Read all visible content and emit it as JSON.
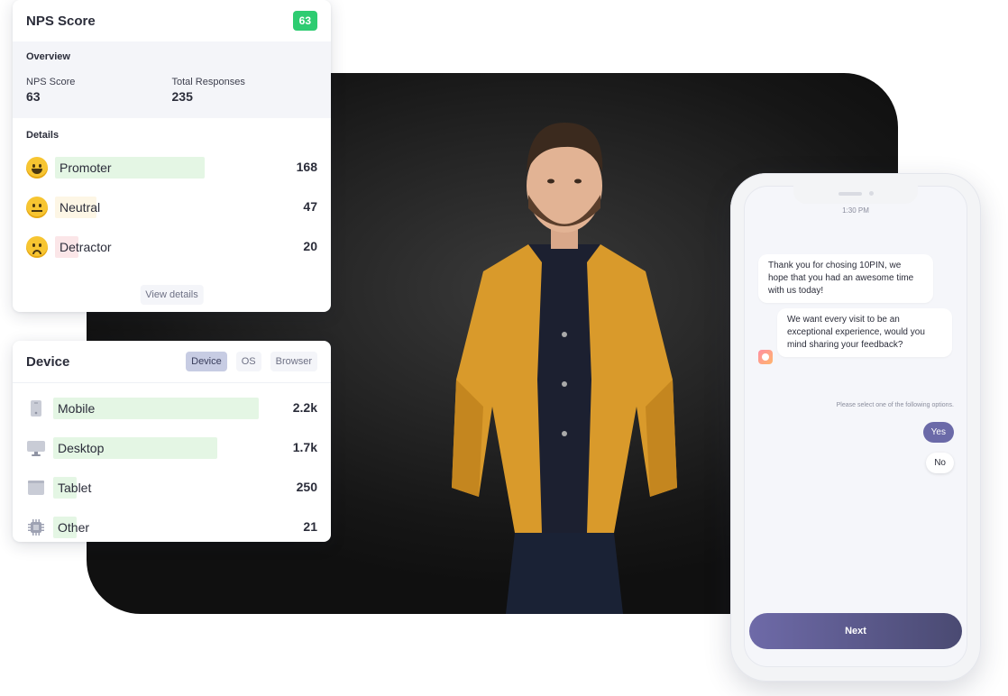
{
  "nps_card": {
    "title": "NPS Score",
    "badge": "63",
    "overview_label": "Overview",
    "stats": [
      {
        "label": "NPS Score",
        "value": "63"
      },
      {
        "label": "Total Responses",
        "value": "235"
      }
    ],
    "details_label": "Details",
    "rows": [
      {
        "label": "Promoter",
        "count": "168",
        "fraction": 0.72,
        "color": "#e4f6e4",
        "icon": "happy-face-icon"
      },
      {
        "label": "Neutral",
        "count": "47",
        "fraction": 0.2,
        "color": "#fdf6e5",
        "icon": "neutral-face-icon"
      },
      {
        "label": "Detractor",
        "count": "20",
        "fraction": 0.09,
        "color": "#fbe6e8",
        "icon": "sad-face-icon"
      }
    ],
    "view_details": "View details"
  },
  "device_card": {
    "title": "Device",
    "tabs": [
      "Device",
      "OS",
      "Browser"
    ],
    "active_tab": "Device",
    "rows": [
      {
        "label": "Mobile",
        "count": "2.2k",
        "fraction": 0.95,
        "color": "#e4f6e4",
        "icon": "mobile-icon"
      },
      {
        "label": "Desktop",
        "count": "1.7k",
        "fraction": 0.76,
        "color": "#e4f6e4",
        "icon": "desktop-icon"
      },
      {
        "label": "Tablet",
        "count": "250",
        "fraction": 0.11,
        "color": "#e4f6e4",
        "icon": "tablet-icon"
      },
      {
        "label": "Other",
        "count": "21",
        "fraction": 0.01,
        "color": "#e4f6e4",
        "icon": "chip-icon"
      }
    ]
  },
  "phone": {
    "time": "1:30 PM",
    "messages": [
      "Thank you for chosing 10PIN, we hope that you had an awesome time with us today!",
      "We want every visit to be an exceptional experience, would you mind sharing your feedback?"
    ],
    "hint": "Please select one of the following options.",
    "options": [
      "Yes",
      "No"
    ],
    "next_label": "Next"
  },
  "colors": {
    "badge_green": "#2ecc71",
    "accent_purple": "#6b6aa8"
  }
}
